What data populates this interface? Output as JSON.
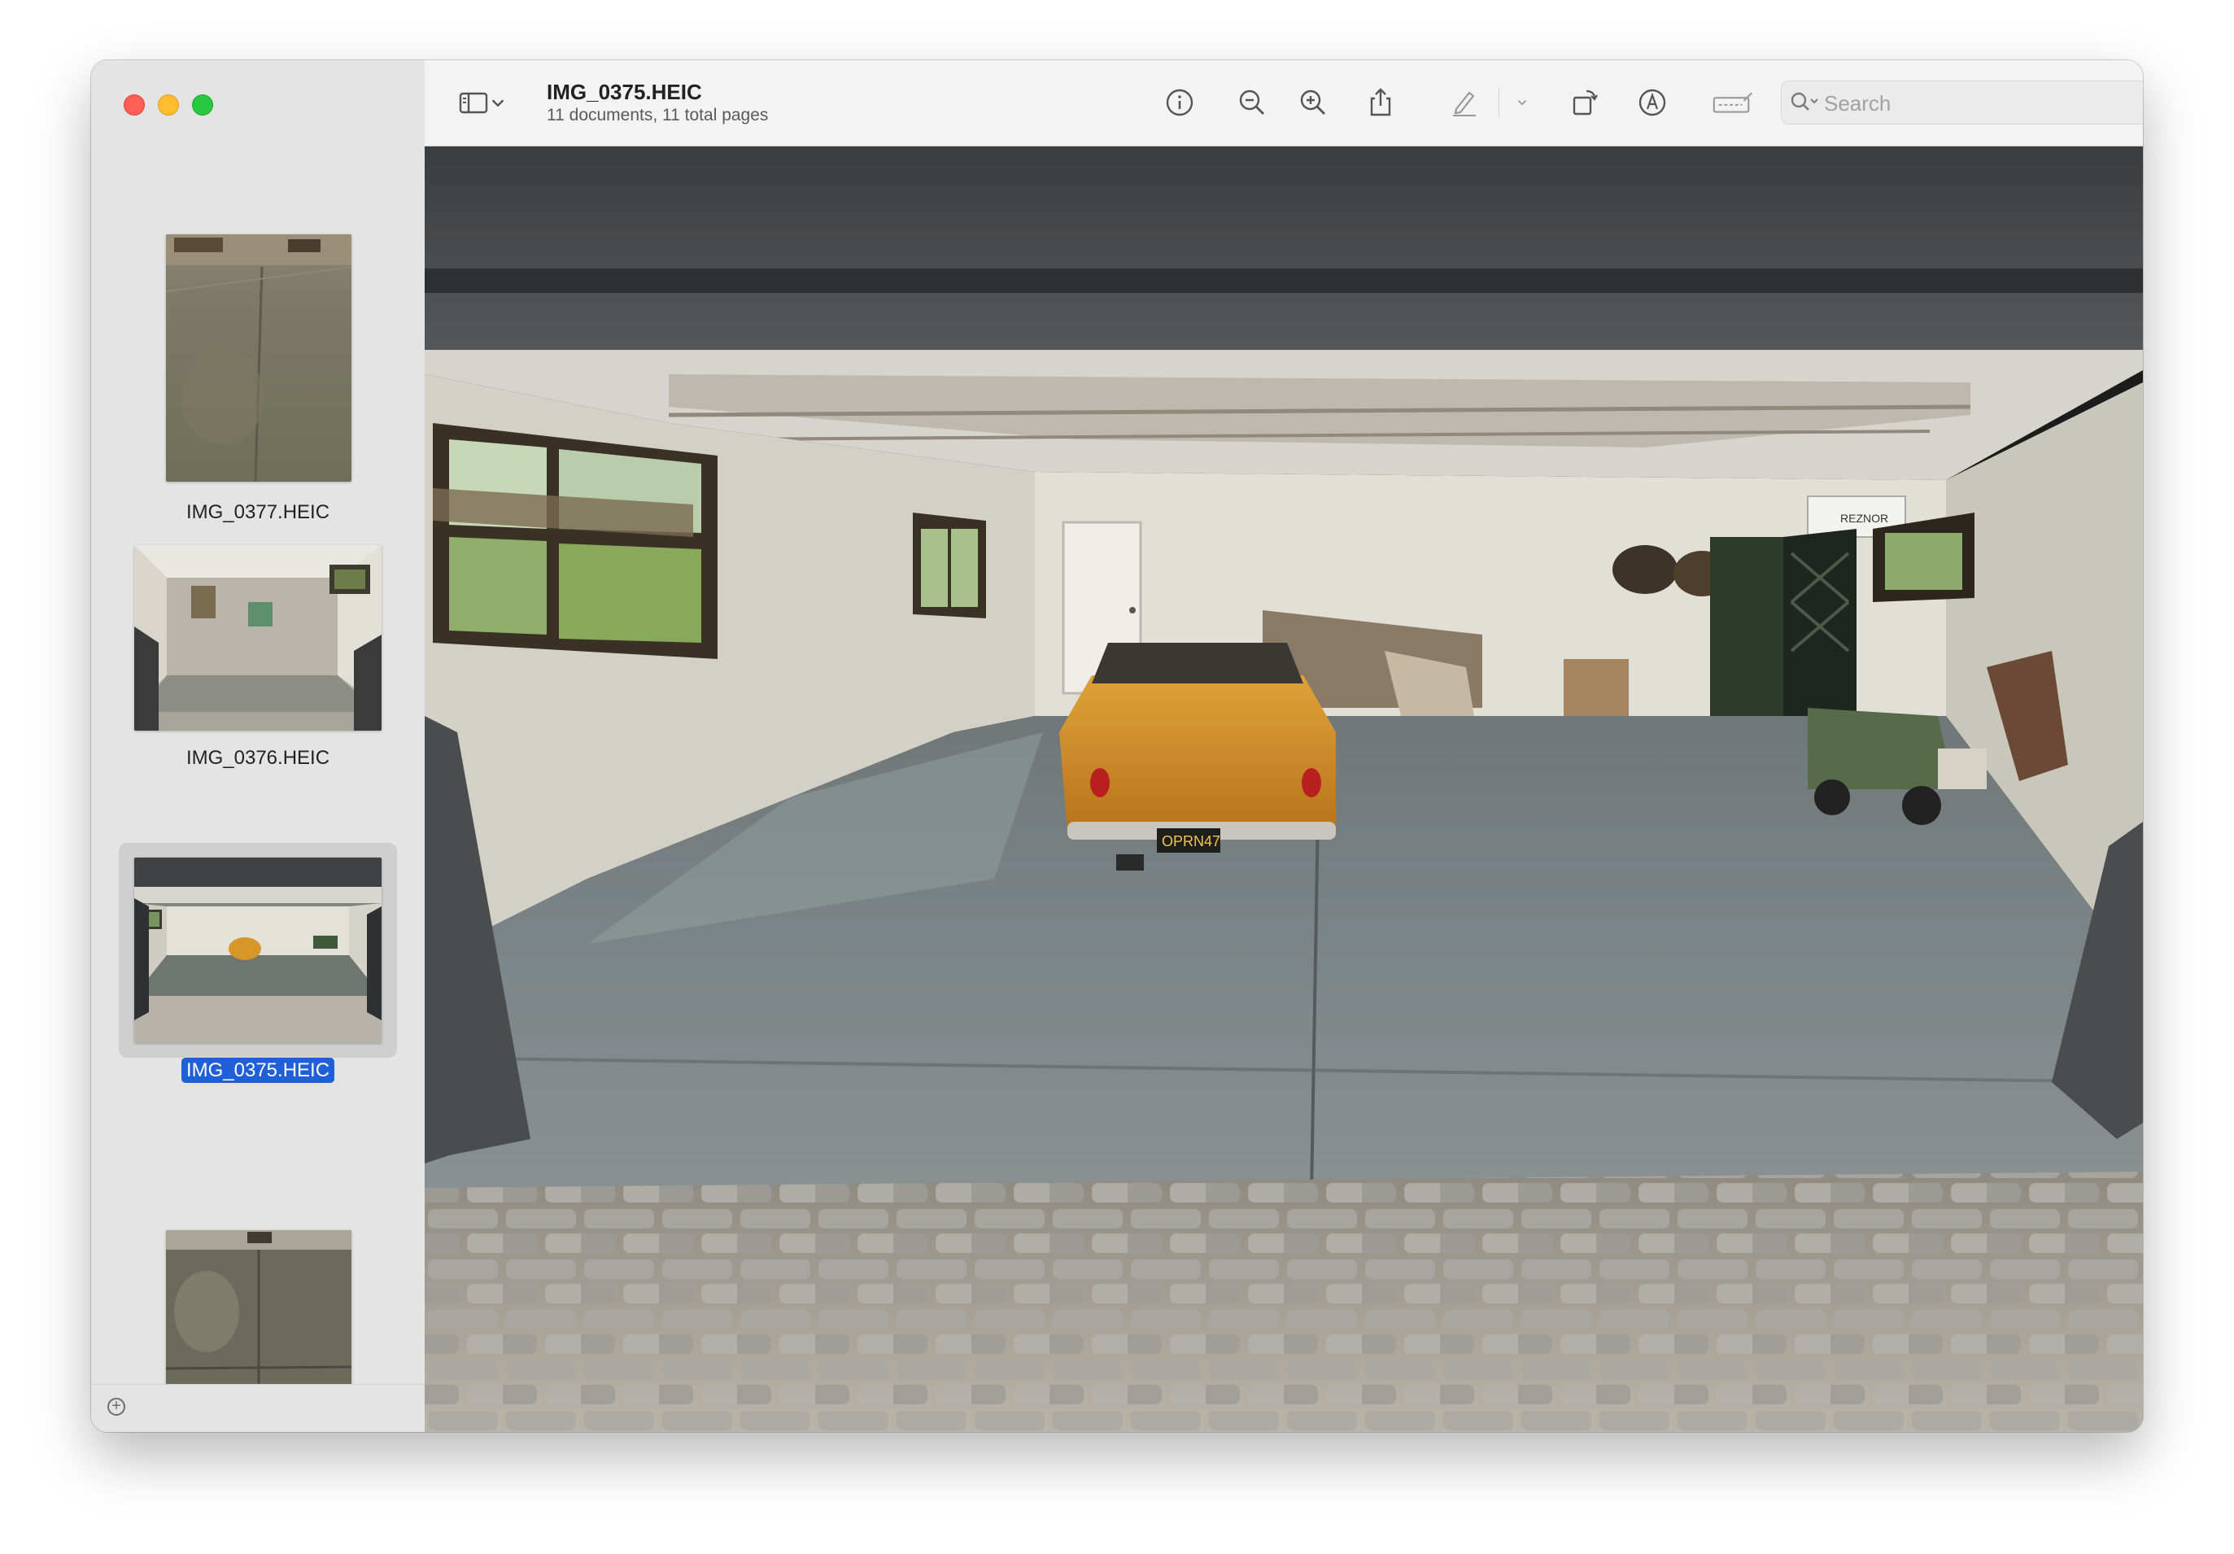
{
  "window": {
    "title": "IMG_0375.HEIC",
    "subtitle": "11 documents, 11 total pages"
  },
  "toolbar": {
    "sidebar_toggle_icon": "sidebar-icon",
    "icons": [
      "info-icon",
      "zoom-out-icon",
      "zoom-in-icon",
      "share-icon",
      "markup-pen-icon",
      "chevron-down-icon",
      "rotate-icon",
      "annotate-icon",
      "adjust-size-icon"
    ],
    "search_placeholder": "Search"
  },
  "sidebar": {
    "items": [
      {
        "label": "IMG_0377.HEIC",
        "selected": false
      },
      {
        "label": "IMG_0376.HEIC",
        "selected": false
      },
      {
        "label": "IMG_0375.HEIC",
        "selected": true
      },
      {
        "label": "",
        "selected": false
      }
    ],
    "add_icon": "plus-circle-icon"
  },
  "image": {
    "license_plate": "OPRN47",
    "heater_label": "REZNOR"
  },
  "colors": {
    "selection": "#1f5fd8",
    "close": "#ff5f57",
    "minimize": "#febc2e",
    "maximize": "#28c840"
  }
}
